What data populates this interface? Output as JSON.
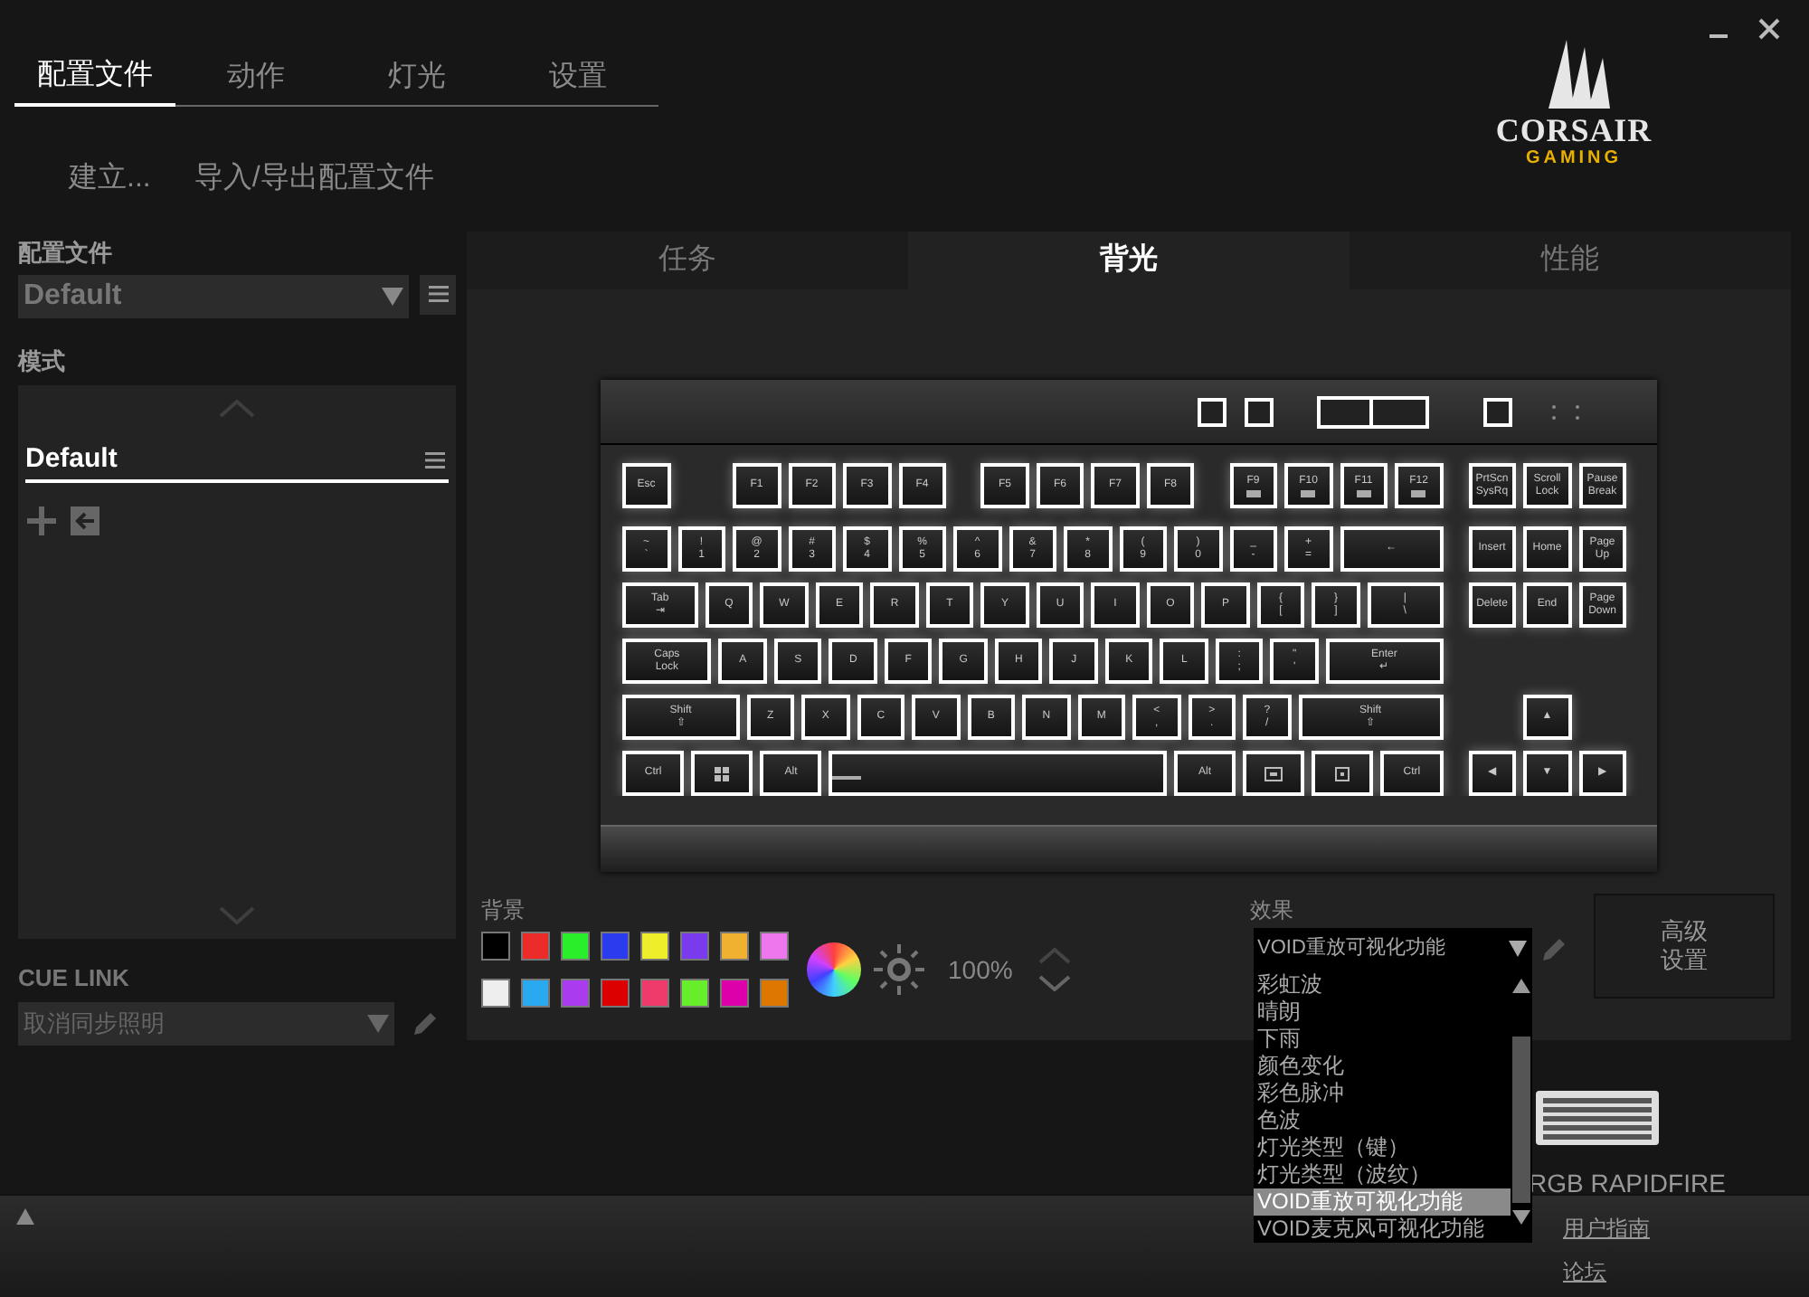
{
  "nav_tabs": [
    {
      "label": "配置文件",
      "selected": true
    },
    {
      "label": "动作",
      "selected": false
    },
    {
      "label": "灯光",
      "selected": false
    },
    {
      "label": "设置",
      "selected": false
    }
  ],
  "sub_actions": [
    "建立...",
    "导入/导出配置文件"
  ],
  "logo": {
    "name": "CORSAIR",
    "tagline": "GAMING"
  },
  "sidebar": {
    "profile_label": "配置文件",
    "profile_value": "Default",
    "modes_label": "模式",
    "modes": [
      {
        "label": "Default",
        "selected": true
      }
    ],
    "cue_link_label": "CUE LINK",
    "cue_link_value": "取消同步照明"
  },
  "panel_tabs": [
    {
      "label": "任务",
      "selected": false
    },
    {
      "label": "背光",
      "selected": true
    },
    {
      "label": "性能",
      "selected": false
    }
  ],
  "keyboard": {
    "main_rows": [
      [
        {
          "label": "Esc"
        },
        {
          "label": "F1"
        },
        {
          "label": "F2"
        },
        {
          "label": "F3"
        },
        {
          "label": "F4"
        },
        {
          "label": "F5"
        },
        {
          "label": "F6"
        },
        {
          "label": "F7"
        },
        {
          "label": "F8"
        },
        {
          "label": "F9",
          "kind": "media"
        },
        {
          "label": "F10",
          "kind": "media"
        },
        {
          "label": "F11",
          "kind": "media"
        },
        {
          "label": "F12",
          "kind": "media"
        }
      ],
      [
        {
          "label": "~\n`"
        },
        {
          "label": "!\n1"
        },
        {
          "label": "@\n2"
        },
        {
          "label": "#\n3"
        },
        {
          "label": "$\n4"
        },
        {
          "label": "%\n5"
        },
        {
          "label": "^\n6"
        },
        {
          "label": "&\n7"
        },
        {
          "label": "*\n8"
        },
        {
          "label": "(\n9"
        },
        {
          "label": ")\n0"
        },
        {
          "label": "_\n-"
        },
        {
          "label": "+\n="
        },
        {
          "label": "←"
        }
      ],
      [
        {
          "label": "Tab\n⇥"
        },
        {
          "label": "Q"
        },
        {
          "label": "W"
        },
        {
          "label": "E"
        },
        {
          "label": "R"
        },
        {
          "label": "T"
        },
        {
          "label": "Y"
        },
        {
          "label": "U"
        },
        {
          "label": "I"
        },
        {
          "label": "O"
        },
        {
          "label": "P"
        },
        {
          "label": "{\n["
        },
        {
          "label": "}\n]"
        },
        {
          "label": "|\n\\"
        }
      ],
      [
        {
          "label": "Caps\nLock"
        },
        {
          "label": "A"
        },
        {
          "label": "S"
        },
        {
          "label": "D"
        },
        {
          "label": "F"
        },
        {
          "label": "G"
        },
        {
          "label": "H"
        },
        {
          "label": "J"
        },
        {
          "label": "K"
        },
        {
          "label": "L"
        },
        {
          "label": ":\n;"
        },
        {
          "label": "\"\n'"
        },
        {
          "label": "Enter\n↵"
        }
      ],
      [
        {
          "label": "Shift\n⇧"
        },
        {
          "label": "Z"
        },
        {
          "label": "X"
        },
        {
          "label": "C"
        },
        {
          "label": "V"
        },
        {
          "label": "B"
        },
        {
          "label": "N"
        },
        {
          "label": "M"
        },
        {
          "label": "<\n,"
        },
        {
          "label": ">\n."
        },
        {
          "label": "?\n/"
        },
        {
          "label": "Shift\n⇧"
        }
      ],
      [
        {
          "label": "Ctrl"
        },
        {
          "kind": "windows"
        },
        {
          "label": "Alt"
        },
        {
          "kind": "space"
        },
        {
          "label": "Alt"
        },
        {
          "kind": "function"
        },
        {
          "kind": "menu"
        },
        {
          "label": "Ctrl"
        }
      ]
    ],
    "nav_rows": [
      [
        {
          "label": "PrtScn\nSysRq"
        },
        {
          "label": "Scroll\nLock"
        },
        {
          "label": "Pause\nBreak"
        }
      ],
      [
        {
          "label": "Insert"
        },
        {
          "label": "Home"
        },
        {
          "label": "Page\nUp"
        }
      ],
      [
        {
          "label": "Delete"
        },
        {
          "label": "End"
        },
        {
          "label": "Page\nDown"
        }
      ],
      [],
      [
        {
          "label": "▲"
        }
      ],
      [
        {
          "label": "◀"
        },
        {
          "label": "▼"
        },
        {
          "label": "▶"
        }
      ]
    ]
  },
  "background": {
    "label": "背景",
    "swatches": [
      {
        "color": "#000000"
      },
      {
        "color": "#ee2b2b"
      },
      {
        "color": "#2bee2b"
      },
      {
        "color": "#2b3bee"
      },
      {
        "color": "#eeee2b"
      },
      {
        "color": "#7a3bee"
      },
      {
        "color": "#f0b030"
      },
      {
        "color": "#ee77ee"
      },
      {
        "color": "#eeeeee"
      },
      {
        "color": "#2aaaee"
      },
      {
        "color": "#aa3bee"
      },
      {
        "color": "#dd0000"
      },
      {
        "color": "#ee3b6b"
      },
      {
        "color": "#66ee2b"
      },
      {
        "color": "#dd00aa"
      },
      {
        "color": "#dd7700"
      }
    ],
    "brightness": "100%"
  },
  "effect": {
    "label": "效果",
    "value": "VOID重放可视化功能",
    "options": [
      {
        "label": "彩虹波",
        "selected": false
      },
      {
        "label": "晴朗",
        "selected": false
      },
      {
        "label": "下雨",
        "selected": false
      },
      {
        "label": "颜色变化",
        "selected": false
      },
      {
        "label": "彩色脉冲",
        "selected": false
      },
      {
        "label": "色波",
        "selected": false
      },
      {
        "label": "灯光类型（键）",
        "selected": false
      },
      {
        "label": "灯光类型（波纹）",
        "selected": false
      },
      {
        "label": "VOID重放可视化功能",
        "selected": true
      },
      {
        "label": "VOID麦克风可视化功能",
        "selected": false
      }
    ]
  },
  "advanced_button": "高级设置",
  "device": {
    "name": "RGB RAPIDFIRE",
    "links": [
      "用户指南",
      "论坛"
    ]
  }
}
